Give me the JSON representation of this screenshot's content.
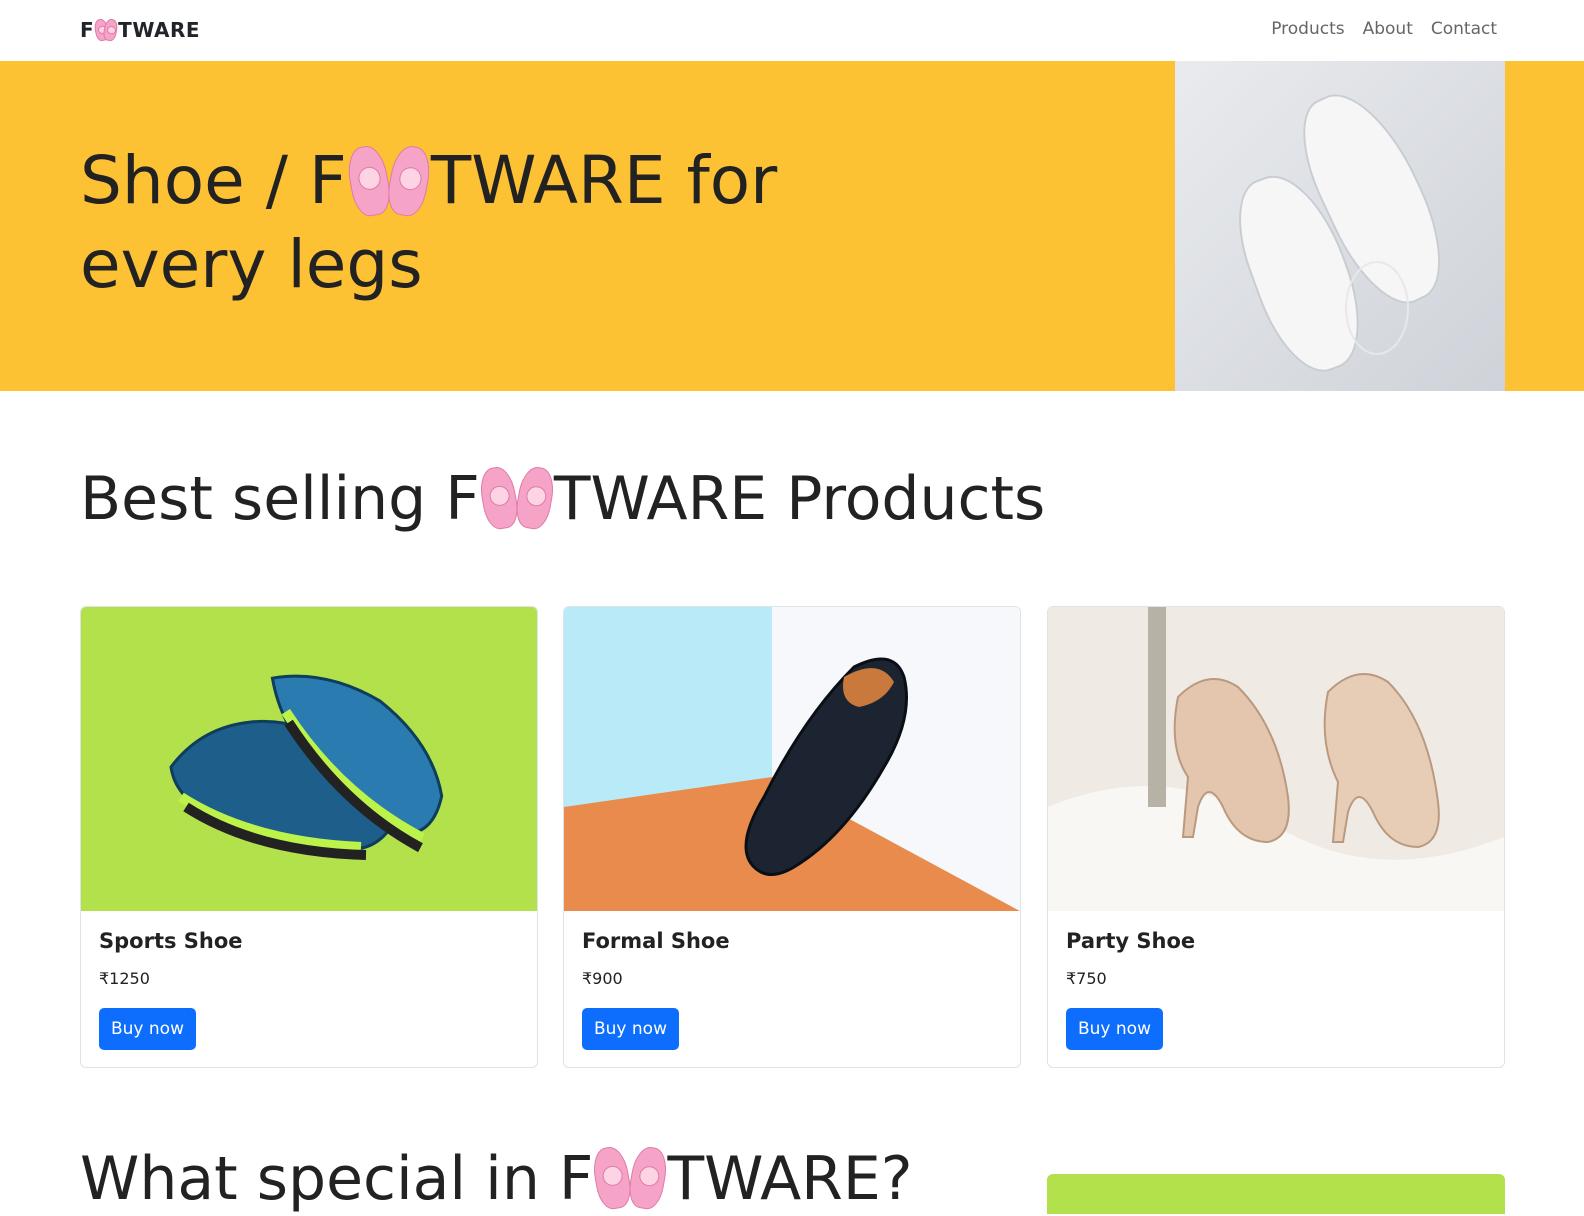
{
  "navbar": {
    "brand_prefix": "F",
    "brand_suffix": "TWARE",
    "brand_icon": "ballet-shoes-icon",
    "links": [
      "Products",
      "About",
      "Contact"
    ]
  },
  "hero": {
    "title_part1": "Shoe / F",
    "title_part2": "TWARE for every legs",
    "icon": "ballet-shoes-icon"
  },
  "best_selling": {
    "title_part1": "Best selling F",
    "title_part2": "TWARE Products",
    "products": [
      {
        "name": "Sports Shoe",
        "price": "₹1250",
        "button": "Buy now"
      },
      {
        "name": "Formal Shoe",
        "price": "₹900",
        "button": "Buy now"
      },
      {
        "name": "Party Shoe",
        "price": "₹750",
        "button": "Buy now"
      }
    ]
  },
  "special": {
    "title_part1": "What special in F",
    "title_part2": "TWARE?"
  },
  "colors": {
    "hero_bg": "#fdc134",
    "primary_button": "#0d6efd",
    "accent_green": "#b2e14c"
  }
}
